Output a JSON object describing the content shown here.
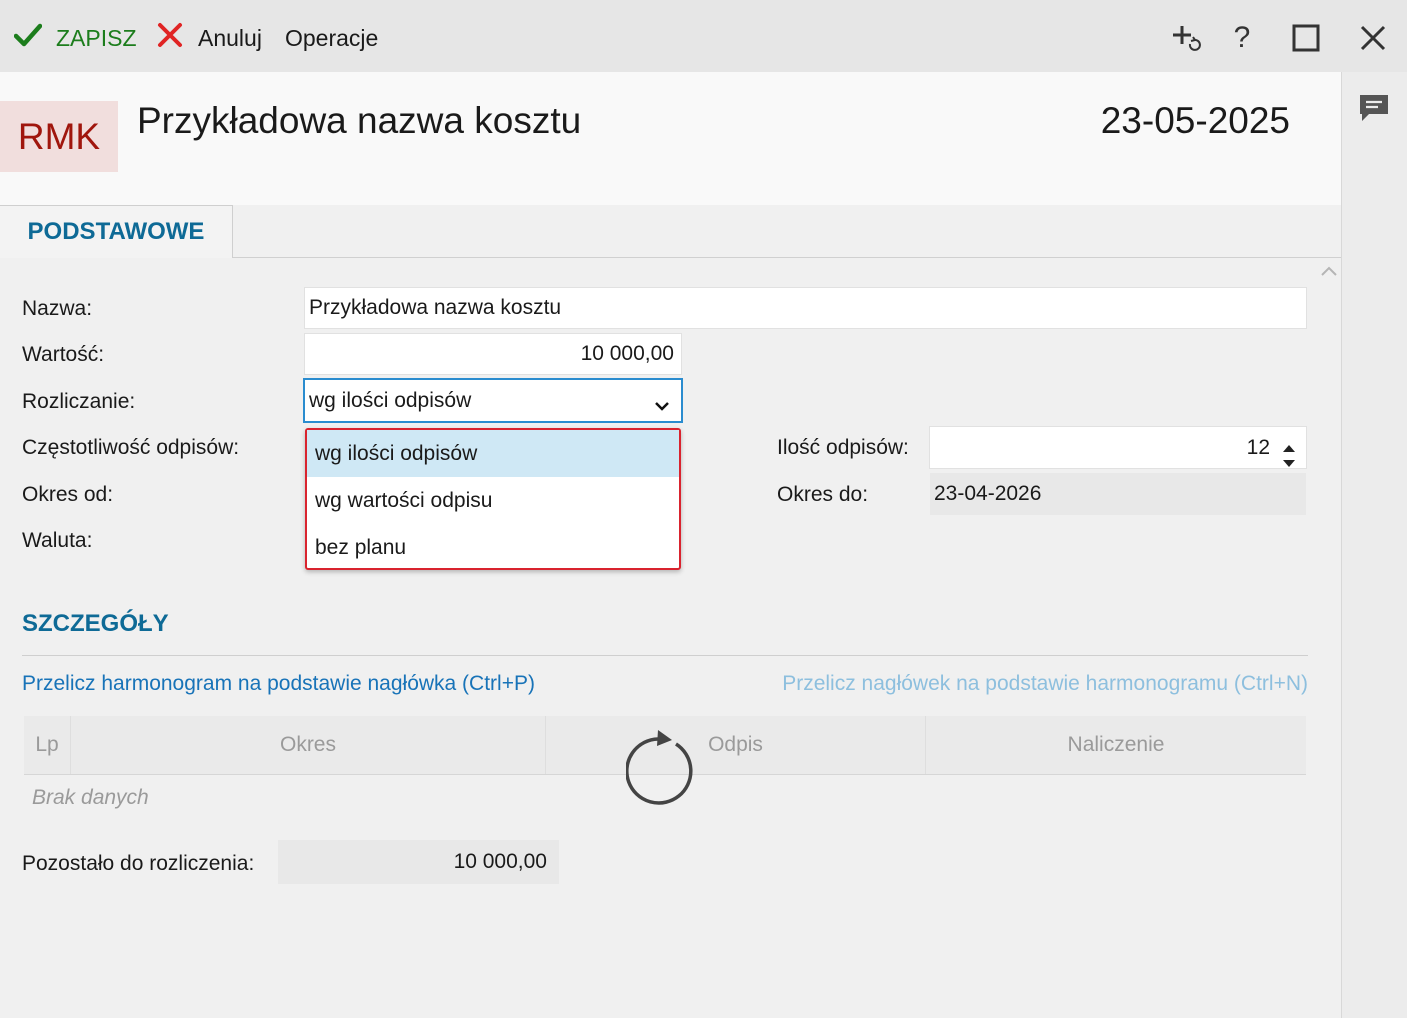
{
  "toolbar": {
    "save_label": "ZAPISZ",
    "cancel_label": "Anuluj",
    "operations_label": "Operacje",
    "icons": [
      "add-refresh-icon",
      "help-icon",
      "maximize-icon",
      "close-icon"
    ],
    "help_glyph": "?"
  },
  "header": {
    "badge": "RMK",
    "title": "Przykładowa nazwa kosztu",
    "date": "23-05-2025"
  },
  "tabs": [
    {
      "label": "PODSTAWOWE",
      "active": true
    }
  ],
  "form": {
    "nazwa_label": "Nazwa:",
    "nazwa_value": "Przykładowa nazwa kosztu",
    "wartosc_label": "Wartość:",
    "wartosc_value": "10 000,00",
    "rozliczanie_label": "Rozliczanie:",
    "rozliczanie_value": "wg ilości odpisów",
    "czestotliwosc_label": "Częstotliwość odpisów:",
    "okres_od_label": "Okres od:",
    "waluta_label": "Waluta:",
    "ilosc_label": "Ilość odpisów:",
    "ilosc_value": "12",
    "okres_do_label": "Okres do:",
    "okres_do_value": "23-04-2026"
  },
  "dropdown": {
    "options": [
      "wg ilości odpisów",
      "wg wartości odpisu",
      "bez planu"
    ],
    "selected_index": 0
  },
  "details": {
    "section_title": "SZCZEGÓŁY",
    "link_recalc_schedule": "Przelicz harmonogram na podstawie nagłówka (Ctrl+P)",
    "link_recalc_header": "Przelicz nagłówek na podstawie harmonogramu (Ctrl+N)",
    "columns": [
      "Lp",
      "Okres",
      "Odpis",
      "Naliczenie"
    ],
    "empty_text": "Brak danych",
    "remaining_label": "Pozostało do rozliczenia:",
    "remaining_value": "10 000,00"
  },
  "colors": {
    "accent": "#0e6a96",
    "save_green": "#1c7d1c",
    "cancel_red": "#e02424",
    "badge_bg": "#f1dedd",
    "badge_fg": "#a0160d",
    "dropdown_border": "#d9232e",
    "selection": "#cfe8f5"
  }
}
